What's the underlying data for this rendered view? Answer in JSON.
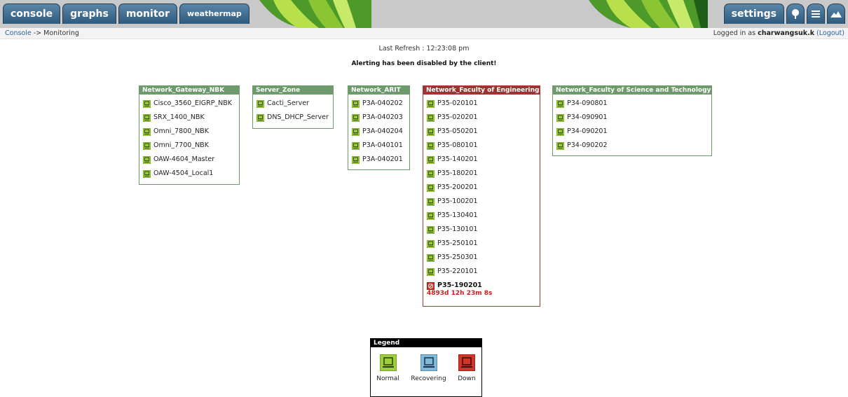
{
  "nav": {
    "tabs": [
      "console",
      "graphs",
      "monitor",
      "weathermap"
    ],
    "settings": "settings",
    "icons": [
      "tree-view-icon",
      "list-view-icon",
      "graph-preview-icon"
    ]
  },
  "breadcrumb": {
    "console": "Console",
    "sep": " -> ",
    "current": "Monitoring"
  },
  "user": {
    "prefix": "Logged in as ",
    "name": "charwangsuk.k",
    "logout": "(Logout)"
  },
  "status": {
    "refresh": "Last Refresh : 12:23:08 pm",
    "alerting": "Alerting has been disabled by the client!"
  },
  "groups": [
    {
      "title": "Network_Gateway_NBK",
      "hosts": [
        "Cisco_3560_EIGRP_NBK",
        "SRX_1400_NBK",
        "Omni_7800_NBK",
        "Omni_7700_NBK",
        "OAW-4604_Master",
        "OAW-4504_Local1"
      ]
    },
    {
      "title": "Server_Zone",
      "hosts": [
        "Cacti_Server",
        "DNS_DHCP_Server"
      ]
    },
    {
      "title": "Network_ARIT",
      "hosts": [
        "P3A-040202",
        "P3A-040203",
        "P3A-040204",
        "P3A-040101",
        "P3A-040201"
      ]
    },
    {
      "title": "Network_Faculty of Engineering",
      "hosts": [
        "P35-020101",
        "P35-020201",
        "P35-050201",
        "P35-080101",
        "P35-140201",
        "P35-180201",
        "P35-200201",
        "P35-100201",
        "P35-130401",
        "P35-130101",
        "P35-250101",
        "P35-250301",
        "P35-220101"
      ],
      "down": {
        "name": "P35-190201",
        "duration": "4893d 12h 23m 8s"
      }
    },
    {
      "title": "Network_Faculty of Science and Technology",
      "hosts": [
        "P34-090801",
        "P34-090901",
        "P34-090201",
        "P34-090202"
      ]
    }
  ],
  "legend": {
    "title": "Legend",
    "items": [
      "Normal",
      "Recovering",
      "Down"
    ]
  },
  "colors": {
    "normal": "#9ccf3a",
    "recovering": "#7fb8d8",
    "down": "#d0352a",
    "tab": "#3b6a8f",
    "group_header": "#6e9a6e",
    "down_header": "#9e3333"
  }
}
